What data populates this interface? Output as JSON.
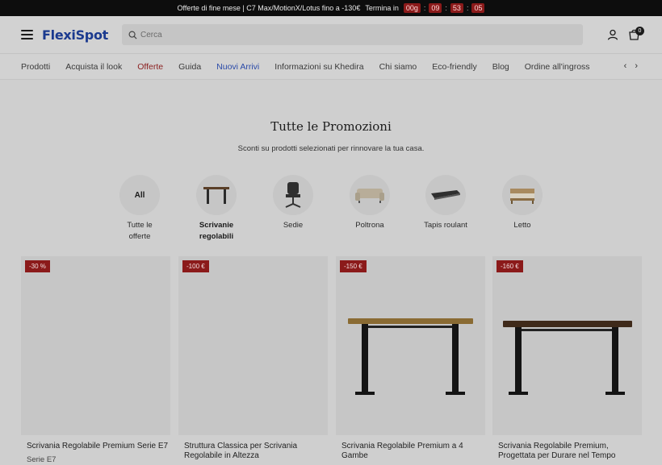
{
  "topbar": {
    "promo_text": "Offerte di fine mese | C7 Max/MotionX/Lotus fino a -130€",
    "countdown_label": "Termina in",
    "days": "00g",
    "hours": "09",
    "minutes": "53",
    "seconds": "05"
  },
  "header": {
    "logo": "FlexiSpot",
    "search_placeholder": "Cerca",
    "cart_count": "0"
  },
  "nav": {
    "items": [
      {
        "label": "Prodotti"
      },
      {
        "label": "Acquista il look"
      },
      {
        "label": "Offerte"
      },
      {
        "label": "Guida"
      },
      {
        "label": "Nuovi Arrivi"
      },
      {
        "label": "Informazioni su Khedira"
      },
      {
        "label": "Chi siamo"
      },
      {
        "label": "Eco-friendly"
      },
      {
        "label": "Blog"
      },
      {
        "label": "Ordine all'ingross"
      }
    ],
    "prev_arrow": "‹",
    "next_arrow": "›"
  },
  "page": {
    "title": "Tutte le Promozioni",
    "subtitle": "Sconti su prodotti selezionati per rinnovare la tua casa."
  },
  "categories": [
    {
      "label": "Tutte le offerte",
      "icon_text": "All"
    },
    {
      "label": "Scrivanie regolabili"
    },
    {
      "label": "Sedie"
    },
    {
      "label": "Poltrona"
    },
    {
      "label": "Tapis roulant"
    },
    {
      "label": "Letto"
    }
  ],
  "products": [
    {
      "badge": "-30 %",
      "name": "Scrivania Regolabile Premium Serie E7",
      "series": "Serie E7"
    },
    {
      "badge": "-100 €",
      "name": "Struttura Classica per Scrivania Regolabile in Altezza"
    },
    {
      "badge": "-150 €",
      "name": "Scrivania Regolabile Premium a 4 Gambe"
    },
    {
      "badge": "-160 €",
      "name": "Scrivania Regolabile Premium, Progettata per Durare nel Tempo"
    }
  ]
}
